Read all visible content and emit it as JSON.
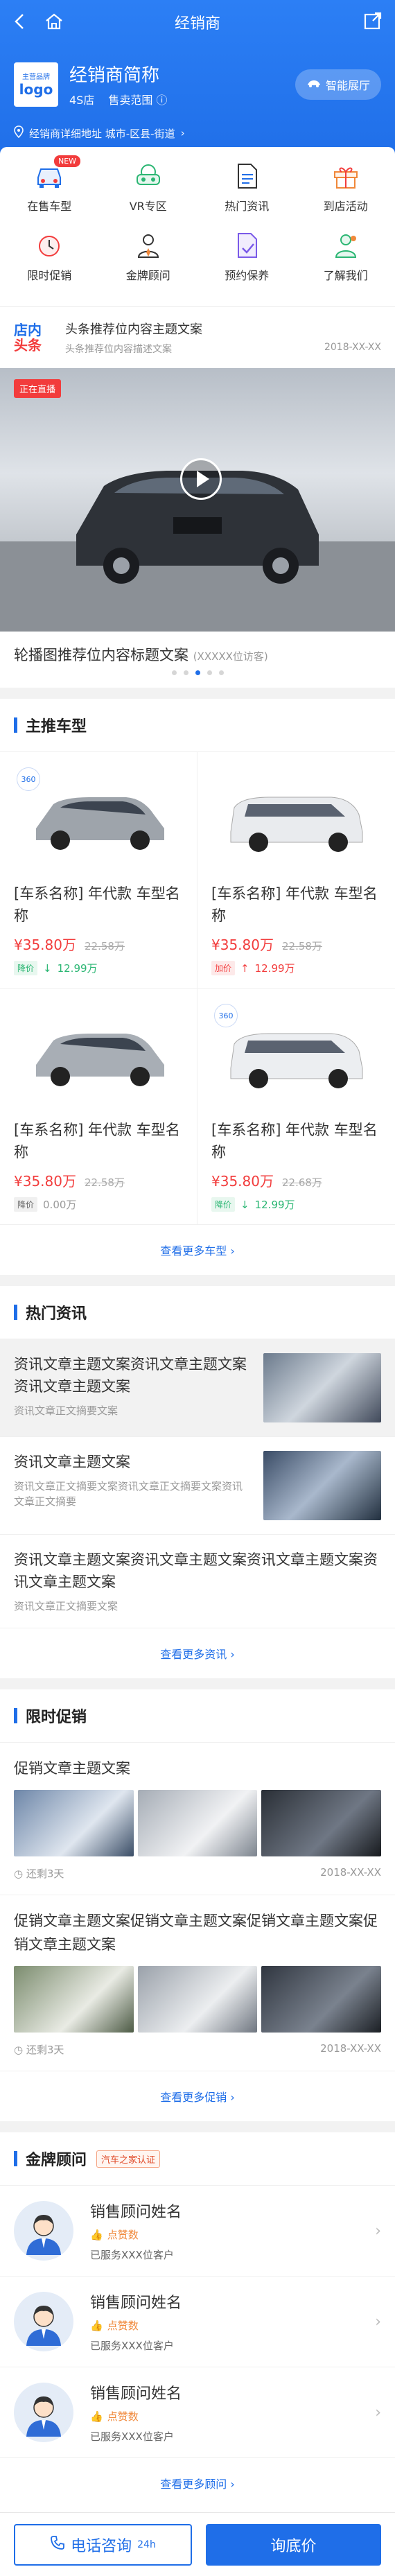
{
  "header": {
    "title": "经销商",
    "dealer_name": "经销商简称",
    "logo_small": "主营品牌",
    "logo_big": "logo",
    "shop_type": "4S店",
    "sales_scope": "售卖范围",
    "showroom_label": "智能展厅",
    "address": "经销商详细地址 城市-区县-街道"
  },
  "grid": [
    {
      "label": "在售车型",
      "icon": "car-icon",
      "badge": "NEW"
    },
    {
      "label": "VR专区",
      "icon": "vr-headset-icon"
    },
    {
      "label": "热门资讯",
      "icon": "document-icon"
    },
    {
      "label": "到店活动",
      "icon": "gift-icon"
    },
    {
      "label": "限时促销",
      "icon": "clock-icon"
    },
    {
      "label": "金牌顾问",
      "icon": "advisor-icon"
    },
    {
      "label": "预约保养",
      "icon": "maintenance-icon"
    },
    {
      "label": "了解我们",
      "icon": "about-icon"
    }
  ],
  "headline": {
    "logo_a": "店内",
    "logo_b": "头条",
    "title": "头条推荐位内容主题文案",
    "sub": "头条推荐位内容描述文案",
    "date": "2018-XX-XX"
  },
  "banner": {
    "live_label": "正在直播",
    "caption": "轮播图推荐位内容标题文案",
    "source": "(XXXXX位访客)"
  },
  "main_cars": {
    "title": "主推车型",
    "items": [
      {
        "name": "[车系名称] 年代款 车型名称",
        "price": "¥35.80万",
        "old": "22.58万",
        "tag": "降价",
        "change": "12.99万",
        "badge": "360",
        "trend": "down"
      },
      {
        "name": "[车系名称] 年代款 车型名称",
        "price": "¥35.80万",
        "old": "22.58万",
        "tag": "加价",
        "change": "12.99万",
        "badge": "",
        "trend": "up"
      },
      {
        "name": "[车系名称] 年代款 车型名称",
        "price": "¥35.80万",
        "old": "22.58万",
        "tag": "降价",
        "change": "0.00万",
        "badge": "",
        "trend": "none"
      },
      {
        "name": "[车系名称] 年代款 车型名称",
        "price": "¥35.80万",
        "old": "22.68万",
        "tag": "降价",
        "change": "12.99万",
        "badge": "360",
        "trend": "down"
      }
    ],
    "more": "查看更多车型"
  },
  "news": {
    "title": "热门资讯",
    "items": [
      {
        "title": "资讯文章主题文案资讯文章主题文案资讯文章主题文案",
        "summary": "资讯文章正文摘要文案"
      },
      {
        "title": "资讯文章主题文案",
        "summary": "资讯文章正文摘要文案资讯文章正文摘要文案资讯文章正文摘要"
      },
      {
        "title": "资讯文章主题文案资讯文章主题文案资讯文章主题文案资讯文章主题文案",
        "summary": "资讯文章正文摘要文案"
      }
    ],
    "more": "查看更多资讯"
  },
  "promo": {
    "title": "限时促销",
    "items": [
      {
        "title": "促销文章主题文案",
        "remain": "还剩3天",
        "date": "2018-XX-XX"
      },
      {
        "title": "促销文章主题文案促销文章主题文案促销文章主题文案促销文章主题文案",
        "remain": "还剩3天",
        "date": "2018-XX-XX"
      }
    ],
    "more": "查看更多促销"
  },
  "advisors": {
    "title": "金牌顾问",
    "tag": "汽车之家认证",
    "items": [
      {
        "name": "销售顾问姓名",
        "likes": "点赞数",
        "served": "已服务XXX位客户"
      },
      {
        "name": "销售顾问姓名",
        "likes": "点赞数",
        "served": "已服务XXX位客户"
      },
      {
        "name": "销售顾问姓名",
        "likes": "点赞数",
        "served": "已服务XXX位客户"
      }
    ],
    "more": "查看更多顾问"
  },
  "bottom": {
    "call": "电话咨询",
    "call_hours": "24h",
    "ask": "询底价"
  }
}
